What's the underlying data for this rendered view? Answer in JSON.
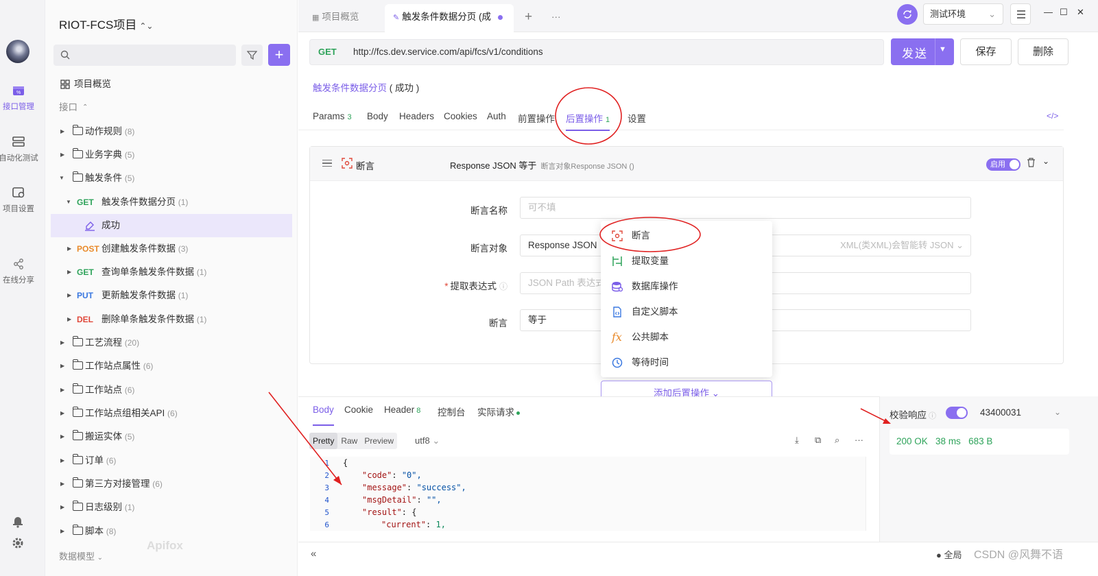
{
  "rail": {
    "items": [
      {
        "label": "接口管理",
        "icon": "interface-icon"
      },
      {
        "label": "自动化测试",
        "icon": "automation-icon"
      },
      {
        "label": "项目设置",
        "icon": "project-settings-icon"
      },
      {
        "label": "在线分享",
        "icon": "share-icon"
      }
    ],
    "bottom_icons": [
      "bell-icon",
      "gear-icon"
    ]
  },
  "sidebar": {
    "project_name": "RIOT-FCS项目",
    "overview_label": "项目概览",
    "section_label": "接口",
    "tree": [
      {
        "label": "动作规则",
        "count": "(8)"
      },
      {
        "label": "业务字典",
        "count": "(5)"
      },
      {
        "label": "触发条件",
        "count": "(5)"
      },
      {
        "method": "GET",
        "label": "触发条件数据分页",
        "count": "(1)"
      },
      {
        "label": "成功"
      },
      {
        "method": "POST",
        "label": "创建触发条件数据",
        "count": "(3)"
      },
      {
        "method": "GET",
        "label": "查询单条触发条件数据",
        "count": "(1)"
      },
      {
        "method": "PUT",
        "label": "更新触发条件数据",
        "count": "(1)"
      },
      {
        "method": "DEL",
        "label": "删除单条触发条件数据",
        "count": "(1)"
      },
      {
        "label": "工艺流程",
        "count": "(20)"
      },
      {
        "label": "工作站点属性",
        "count": "(6)"
      },
      {
        "label": "工作站点",
        "count": "(6)"
      },
      {
        "label": "工作站点组相关API",
        "count": "(6)"
      },
      {
        "label": "搬运实体",
        "count": "(5)"
      },
      {
        "label": "订单",
        "count": "(6)"
      },
      {
        "label": "第三方对接管理",
        "count": "(6)"
      },
      {
        "label": "日志级别",
        "count": "(1)"
      },
      {
        "label": "脚本",
        "count": "(8)"
      }
    ],
    "footer_label": "数据模型",
    "brand": "Apifox"
  },
  "tabs": [
    {
      "label": "项目概览"
    },
    {
      "label": "触发条件数据分页 (成"
    }
  ],
  "env": {
    "selected": "测试环境"
  },
  "request": {
    "method": "GET",
    "url": "http://fcs.dev.service.com/api/fcs/v1/conditions",
    "send_label": "发送",
    "save_label": "保存",
    "delete_label": "删除",
    "breadcrumb_link": "触发条件数据分页",
    "breadcrumb_rest": "( 成功 )"
  },
  "subtabs": [
    {
      "label": "Params",
      "count": "3"
    },
    {
      "label": "Body",
      "count": ""
    },
    {
      "label": "Headers",
      "count": ""
    },
    {
      "label": "Cookies",
      "count": ""
    },
    {
      "label": "Auth",
      "count": ""
    },
    {
      "label": "前置操作",
      "count": ""
    },
    {
      "label": "后置操作",
      "count": "1"
    },
    {
      "label": "设置",
      "count": ""
    }
  ],
  "assertion": {
    "title": "断言",
    "summary": "Response JSON 等于",
    "summary_hint": "断言对象Response JSON ()",
    "enabled_label": "启用",
    "fields": [
      {
        "label": "断言名称",
        "value": "",
        "placeholder": "可不填"
      },
      {
        "label": "断言对象",
        "value": "Response JSON",
        "hint": "XML(类XML)会智能转 JSON"
      },
      {
        "label": "提取表达式",
        "required": true,
        "placeholder": "JSON Path 表达式"
      },
      {
        "label": "断言",
        "value": "等于"
      }
    ]
  },
  "dropdown": {
    "items": [
      {
        "label": "断言",
        "icon": "assert-icon",
        "color": "#e0483a"
      },
      {
        "label": "提取变量",
        "icon": "extract-variable-icon",
        "color": "#2ea35a"
      },
      {
        "label": "数据库操作",
        "icon": "database-icon",
        "color": "#7b5ee8"
      },
      {
        "label": "自定义脚本",
        "icon": "script-icon",
        "color": "#3a78e0"
      },
      {
        "label": "公共脚本",
        "icon": "function-icon",
        "color": "#e98a2a"
      },
      {
        "label": "等待时间",
        "icon": "clock-icon",
        "color": "#3a78e0"
      }
    ],
    "add_label": "添加后置操作"
  },
  "response": {
    "tabs": [
      {
        "label": "Body",
        "count": ""
      },
      {
        "label": "Cookie",
        "count": ""
      },
      {
        "label": "Header",
        "count": "8"
      },
      {
        "label": "控制台",
        "count": ""
      },
      {
        "label": "实际请求",
        "count": ""
      }
    ],
    "formats": [
      "Pretty",
      "Raw",
      "Preview"
    ],
    "encoding": "utf8",
    "lines": [
      {
        "n": "1",
        "text": "{"
      },
      {
        "n": "2",
        "key": "\"code\"",
        "val": "\"0\","
      },
      {
        "n": "3",
        "key": "\"message\"",
        "val": "\"success\","
      },
      {
        "n": "4",
        "key": "\"msgDetail\"",
        "val": "\"\","
      },
      {
        "n": "5",
        "key": "\"result\"",
        "val": "{"
      },
      {
        "n": "6",
        "key": "\"current\"",
        "val": "1,"
      }
    ],
    "verify_label": "校验响应",
    "verify_value": "43400031",
    "status": "200 OK",
    "time": "38 ms",
    "size": "683 B"
  },
  "footer": {
    "global_label": "全局",
    "watermark": "CSDN @风舞不语"
  },
  "colors": {
    "accent": "#8a6ff0",
    "success": "#2ea35a",
    "annotation": "#e02020"
  }
}
